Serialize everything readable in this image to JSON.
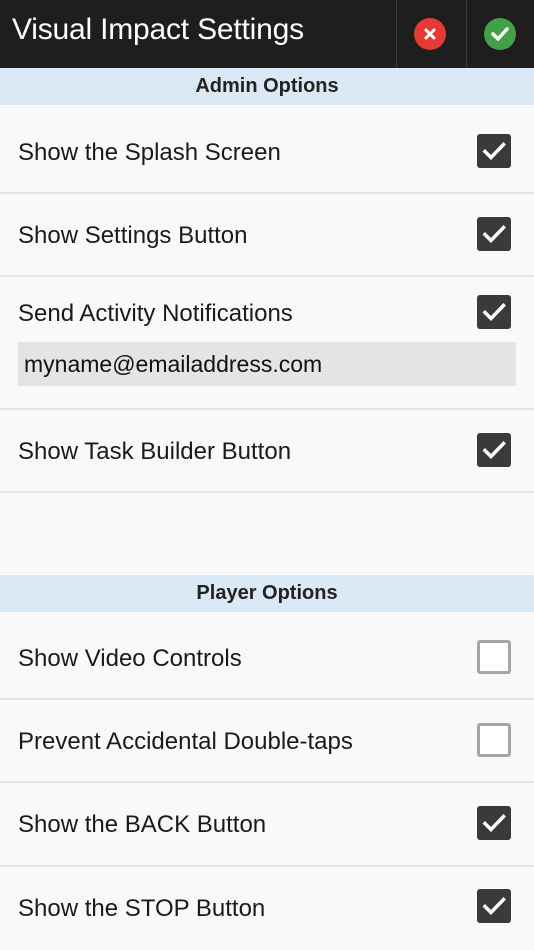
{
  "header": {
    "title": "Visual Impact Settings",
    "cancel_icon": "close-icon",
    "confirm_icon": "check-icon",
    "cancel_color": "#e53935",
    "confirm_color": "#43a047"
  },
  "admin_section": {
    "title": "Admin Options",
    "items": [
      {
        "label": "Show the Splash Screen",
        "checked": true
      },
      {
        "label": "Show Settings Button",
        "checked": true
      },
      {
        "label": "Send Activity Notifications",
        "checked": true
      },
      {
        "label": "Show Task Builder Button",
        "checked": true
      }
    ],
    "notification_email": "myname@emailaddress.com"
  },
  "player_section": {
    "title": "Player Options",
    "items": [
      {
        "label": "Show Video Controls",
        "checked": false
      },
      {
        "label": "Prevent Accidental Double-taps",
        "checked": false
      },
      {
        "label": "Show the BACK Button",
        "checked": true
      },
      {
        "label": "Show the STOP Button",
        "checked": true
      }
    ]
  },
  "colors": {
    "section_header_bg": "#dbe8f5",
    "topbar_bg": "#1e1e1e",
    "checkbox_checked": "#3a3a3a"
  }
}
